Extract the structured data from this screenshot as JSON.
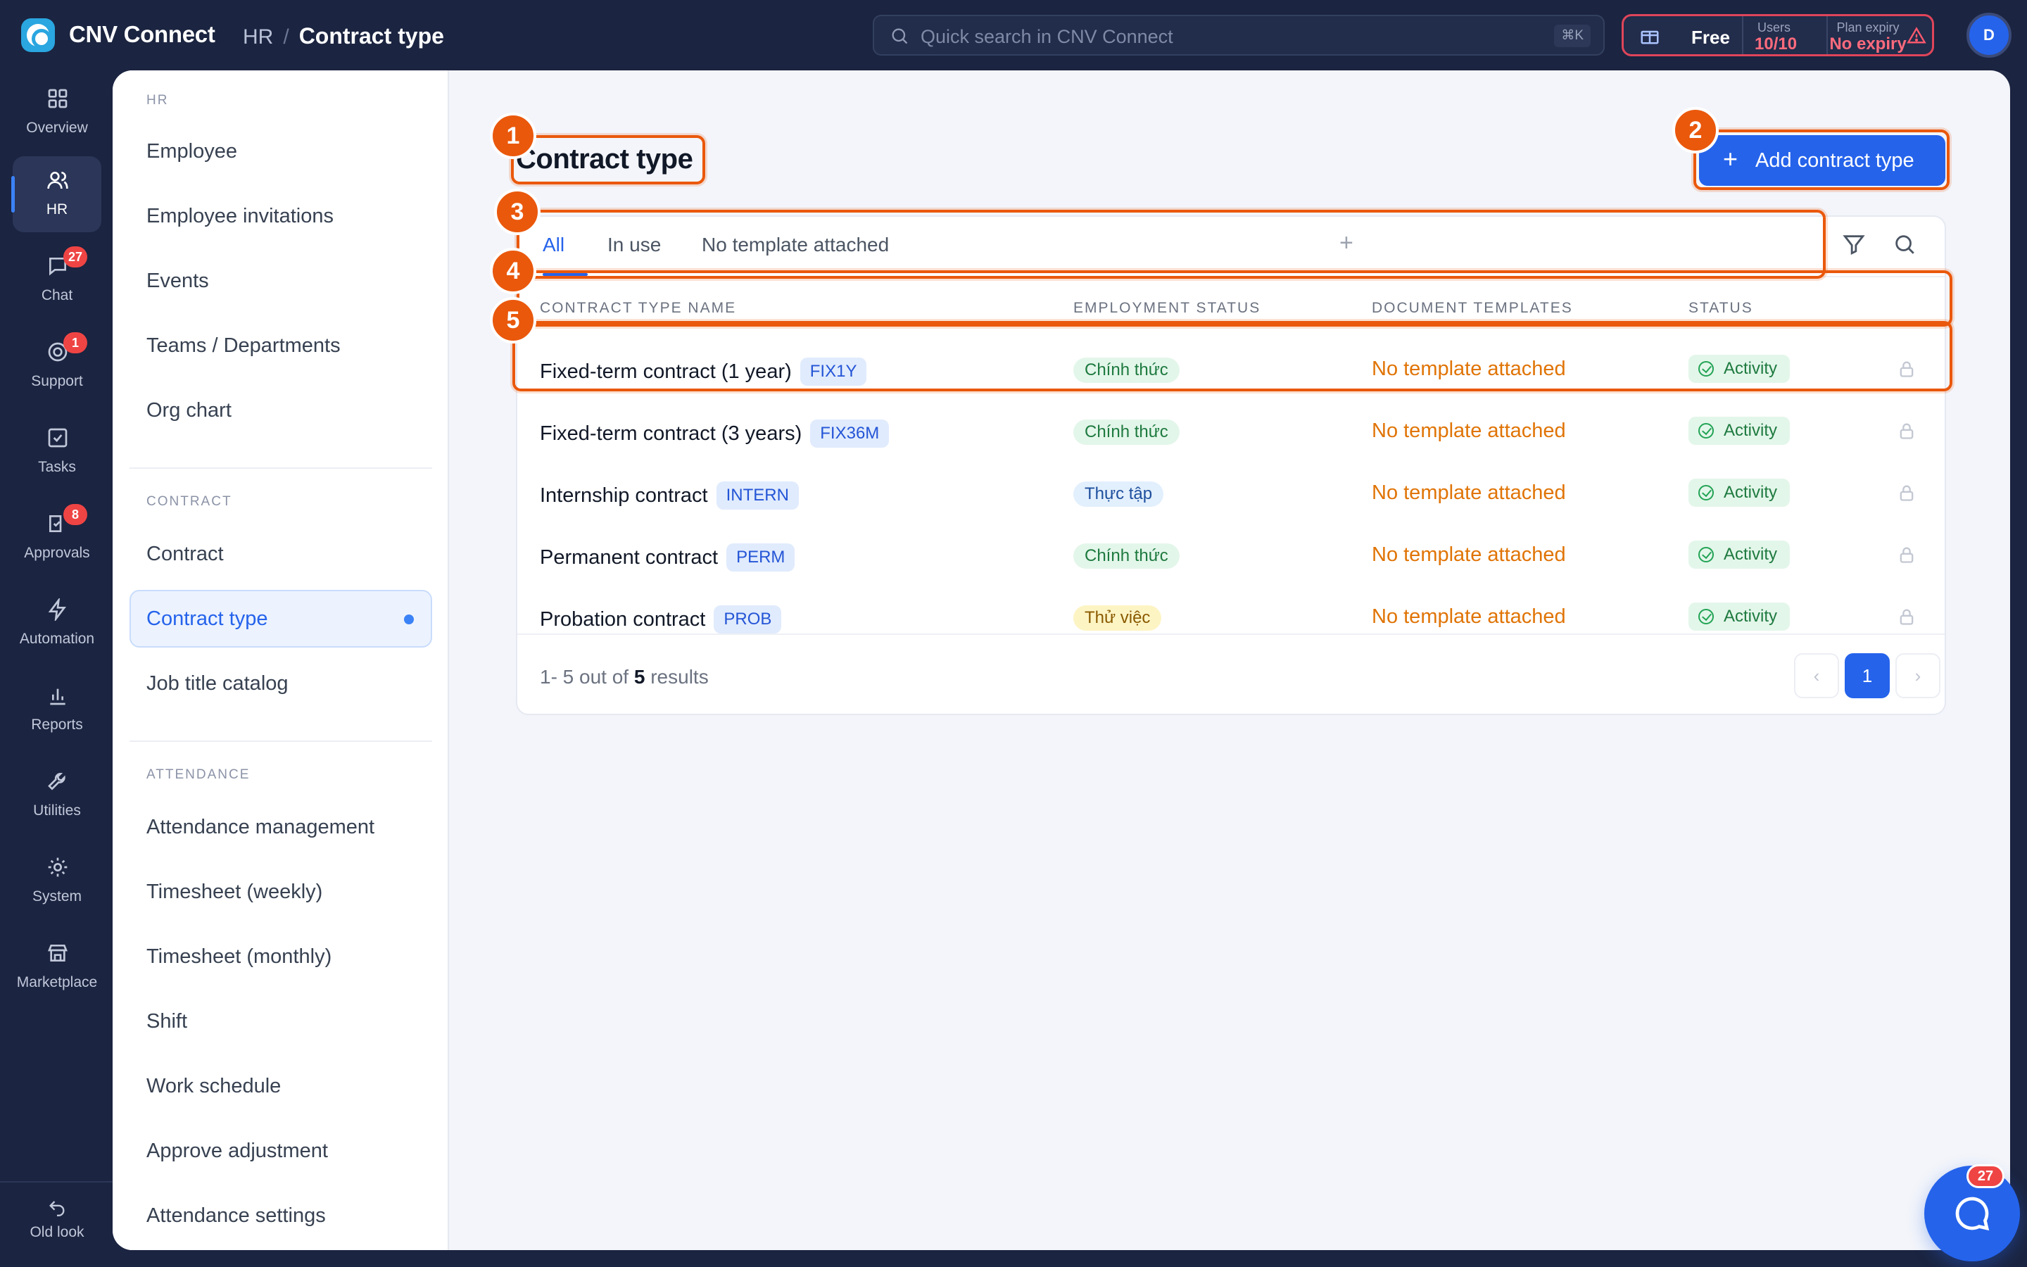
{
  "app": {
    "name": "CNV Connect"
  },
  "breadcrumb": {
    "section": "HR",
    "separator": "/",
    "current": "Contract type"
  },
  "search": {
    "placeholder": "Quick search in CNV Connect",
    "shortcut": "⌘K"
  },
  "plan": {
    "tier": "Free",
    "users_label": "Users",
    "users_value": "10/10",
    "expiry_label": "Plan expiry",
    "expiry_value": "No expiry",
    "warning_color": "#ef4444"
  },
  "user": {
    "initial": "D"
  },
  "rail": {
    "items": [
      {
        "label": "Overview",
        "icon": "grid-icon"
      },
      {
        "label": "HR",
        "icon": "users-icon",
        "active": true
      },
      {
        "label": "Chat",
        "icon": "chat-icon",
        "badge": "27"
      },
      {
        "label": "Support",
        "icon": "support-icon",
        "badge": "1"
      },
      {
        "label": "Tasks",
        "icon": "checkbox-icon"
      },
      {
        "label": "Approvals",
        "icon": "approval-icon",
        "badge": "8"
      },
      {
        "label": "Automation",
        "icon": "bolt-icon"
      },
      {
        "label": "Reports",
        "icon": "bar-chart-icon"
      },
      {
        "label": "Utilities",
        "icon": "wrench-icon"
      },
      {
        "label": "System",
        "icon": "gear-icon"
      },
      {
        "label": "Marketplace",
        "icon": "store-icon"
      }
    ],
    "old_look": "Old look"
  },
  "subnav": {
    "hr_title": "HR",
    "hr_items": [
      "Employee",
      "Employee invitations",
      "Events",
      "Teams / Departments",
      "Org chart"
    ],
    "contract_title": "CONTRACT",
    "contract_items": [
      "Contract",
      "Contract type",
      "Job title catalog"
    ],
    "active_item": "Contract type",
    "attendance_title": "ATTENDANCE",
    "attendance_items": [
      "Attendance management",
      "Timesheet (weekly)",
      "Timesheet (monthly)",
      "Shift",
      "Work schedule",
      "Approve adjustment",
      "Attendance settings"
    ]
  },
  "page": {
    "title": "Contract type",
    "add_button": "Add contract type"
  },
  "tabs": {
    "items": [
      "All",
      "In use",
      "No template attached"
    ],
    "active": "All"
  },
  "table": {
    "headers": [
      "CONTRACT TYPE NAME",
      "EMPLOYMENT STATUS",
      "DOCUMENT TEMPLATES",
      "STATUS"
    ],
    "rows": [
      {
        "name": "Fixed-term contract (1 year)",
        "code": "FIX1Y",
        "employment": "Chính thức",
        "employment_tone": "green",
        "template": "No template attached",
        "status": "Activity"
      },
      {
        "name": "Fixed-term contract (3 years)",
        "code": "FIX36M",
        "employment": "Chính thức",
        "employment_tone": "green",
        "template": "No template attached",
        "status": "Activity"
      },
      {
        "name": "Internship contract",
        "code": "INTERN",
        "employment": "Thực tập",
        "employment_tone": "blue",
        "template": "No template attached",
        "status": "Activity"
      },
      {
        "name": "Permanent contract",
        "code": "PERM",
        "employment": "Chính thức",
        "employment_tone": "green",
        "template": "No template attached",
        "status": "Activity"
      },
      {
        "name": "Probation contract",
        "code": "PROB",
        "employment": "Thử việc",
        "employment_tone": "yellow",
        "template": "No template attached",
        "status": "Activity"
      }
    ]
  },
  "pagination": {
    "range": "1- 5 out of",
    "total": "5",
    "suffix": "results",
    "current_page": "1"
  },
  "annotations": [
    "1",
    "2",
    "3",
    "4",
    "5"
  ],
  "chat_fab": {
    "badge": "27"
  },
  "colors": {
    "accent": "#2563eb",
    "annotation": "#ea580c",
    "nav_bg": "#1b2440",
    "template_warning": "#e07406"
  }
}
